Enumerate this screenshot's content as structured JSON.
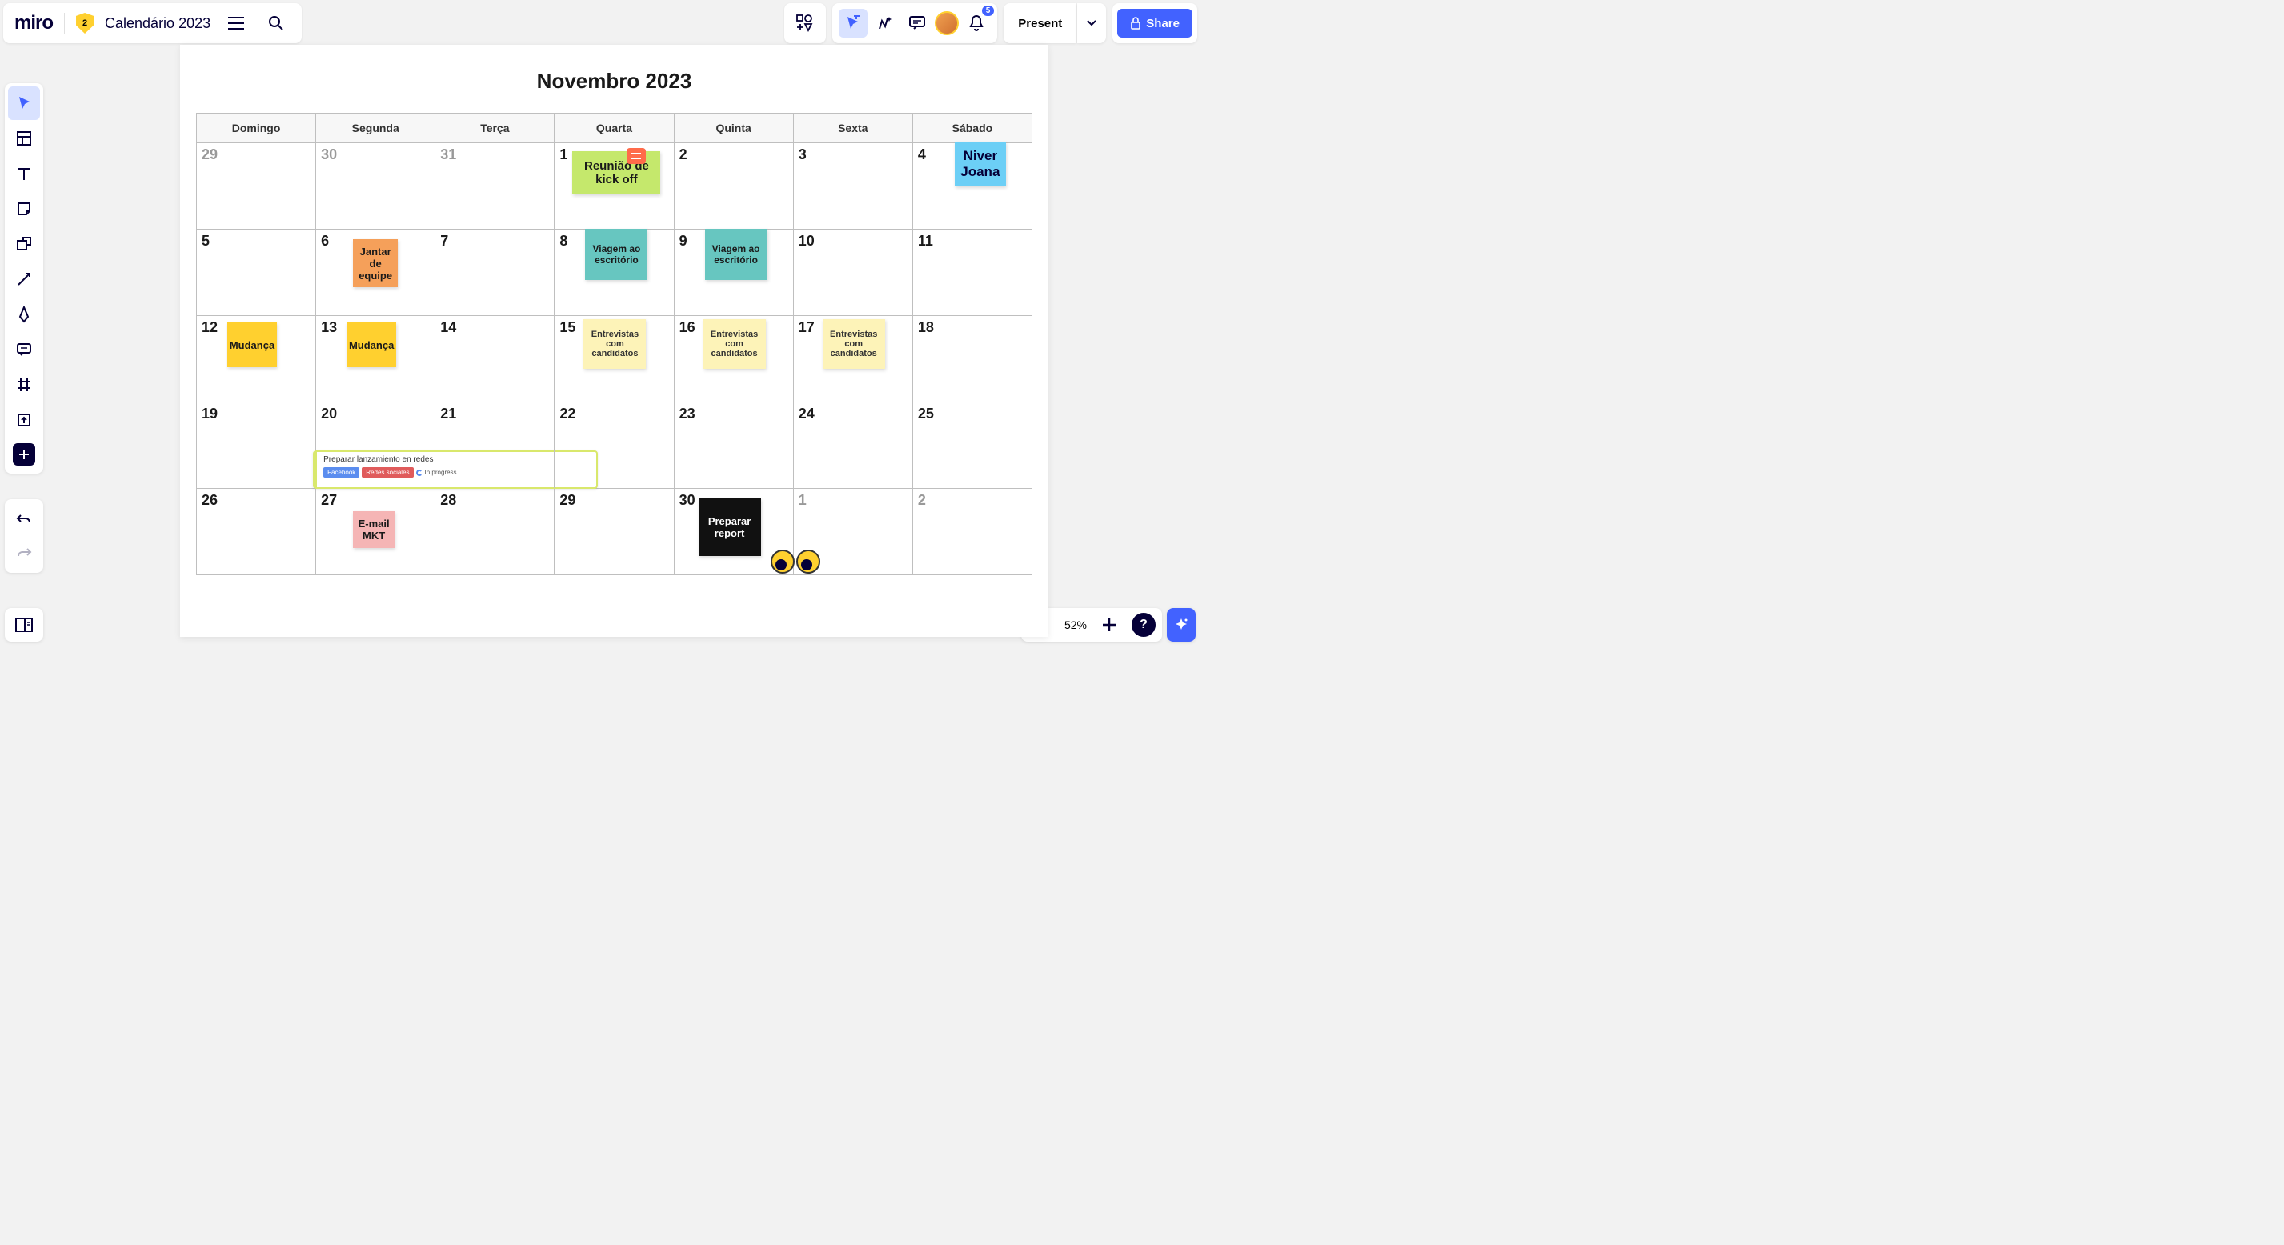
{
  "header": {
    "logo": "miro",
    "shield": "2",
    "board_title": "Calendário 2023",
    "present": "Present",
    "share": "Share",
    "notifications": "5"
  },
  "footer": {
    "zoom": "52%"
  },
  "calendar": {
    "title": "Novembro 2023",
    "days": [
      "Domingo",
      "Segunda",
      "Terça",
      "Quarta",
      "Quinta",
      "Sexta",
      "Sábado"
    ],
    "weeks": [
      [
        {
          "n": "29",
          "fade": true
        },
        {
          "n": "30",
          "fade": true
        },
        {
          "n": "31",
          "fade": true
        },
        {
          "n": "1",
          "sticky": {
            "cls": "green",
            "text": "Reunião de kick off",
            "comment": true
          }
        },
        {
          "n": "2"
        },
        {
          "n": "3"
        },
        {
          "n": "4",
          "sticky": {
            "cls": "blue",
            "text": "Niver Joana"
          }
        }
      ],
      [
        {
          "n": "5"
        },
        {
          "n": "6",
          "sticky": {
            "cls": "orange",
            "text": "Jantar de equipe"
          }
        },
        {
          "n": "7"
        },
        {
          "n": "8",
          "sticky": {
            "cls": "teal",
            "text": "Viagem ao escritório"
          }
        },
        {
          "n": "9",
          "sticky": {
            "cls": "teal",
            "text": "Viagem ao escritório"
          }
        },
        {
          "n": "10"
        },
        {
          "n": "11"
        }
      ],
      [
        {
          "n": "12",
          "sticky": {
            "cls": "yellow",
            "text": "Mudança"
          }
        },
        {
          "n": "13",
          "sticky": {
            "cls": "yellow",
            "text": "Mudança"
          }
        },
        {
          "n": "14"
        },
        {
          "n": "15",
          "sticky": {
            "cls": "paleyellow",
            "text": "Entrevistas com candidatos"
          }
        },
        {
          "n": "16",
          "sticky": {
            "cls": "paleyellow",
            "text": "Entrevistas com candidatos"
          }
        },
        {
          "n": "17",
          "sticky": {
            "cls": "paleyellow",
            "text": "Entrevistas com candidatos"
          }
        },
        {
          "n": "18"
        }
      ],
      [
        {
          "n": "19"
        },
        {
          "n": "20",
          "card": {
            "title": "Preparar lanzamiento en redes",
            "tags": [
              "Facebook",
              "Redes sociales"
            ],
            "status": "In progress"
          }
        },
        {
          "n": "21"
        },
        {
          "n": "22"
        },
        {
          "n": "23"
        },
        {
          "n": "24"
        },
        {
          "n": "25"
        }
      ],
      [
        {
          "n": "26"
        },
        {
          "n": "27",
          "sticky": {
            "cls": "pink",
            "text": "E-mail MKT"
          }
        },
        {
          "n": "28"
        },
        {
          "n": "29"
        },
        {
          "n": "30",
          "sticky": {
            "cls": "black",
            "text": "Preparar report",
            "eyes": true
          }
        },
        {
          "n": "1",
          "fade": true
        },
        {
          "n": "2",
          "fade": true
        }
      ]
    ]
  }
}
